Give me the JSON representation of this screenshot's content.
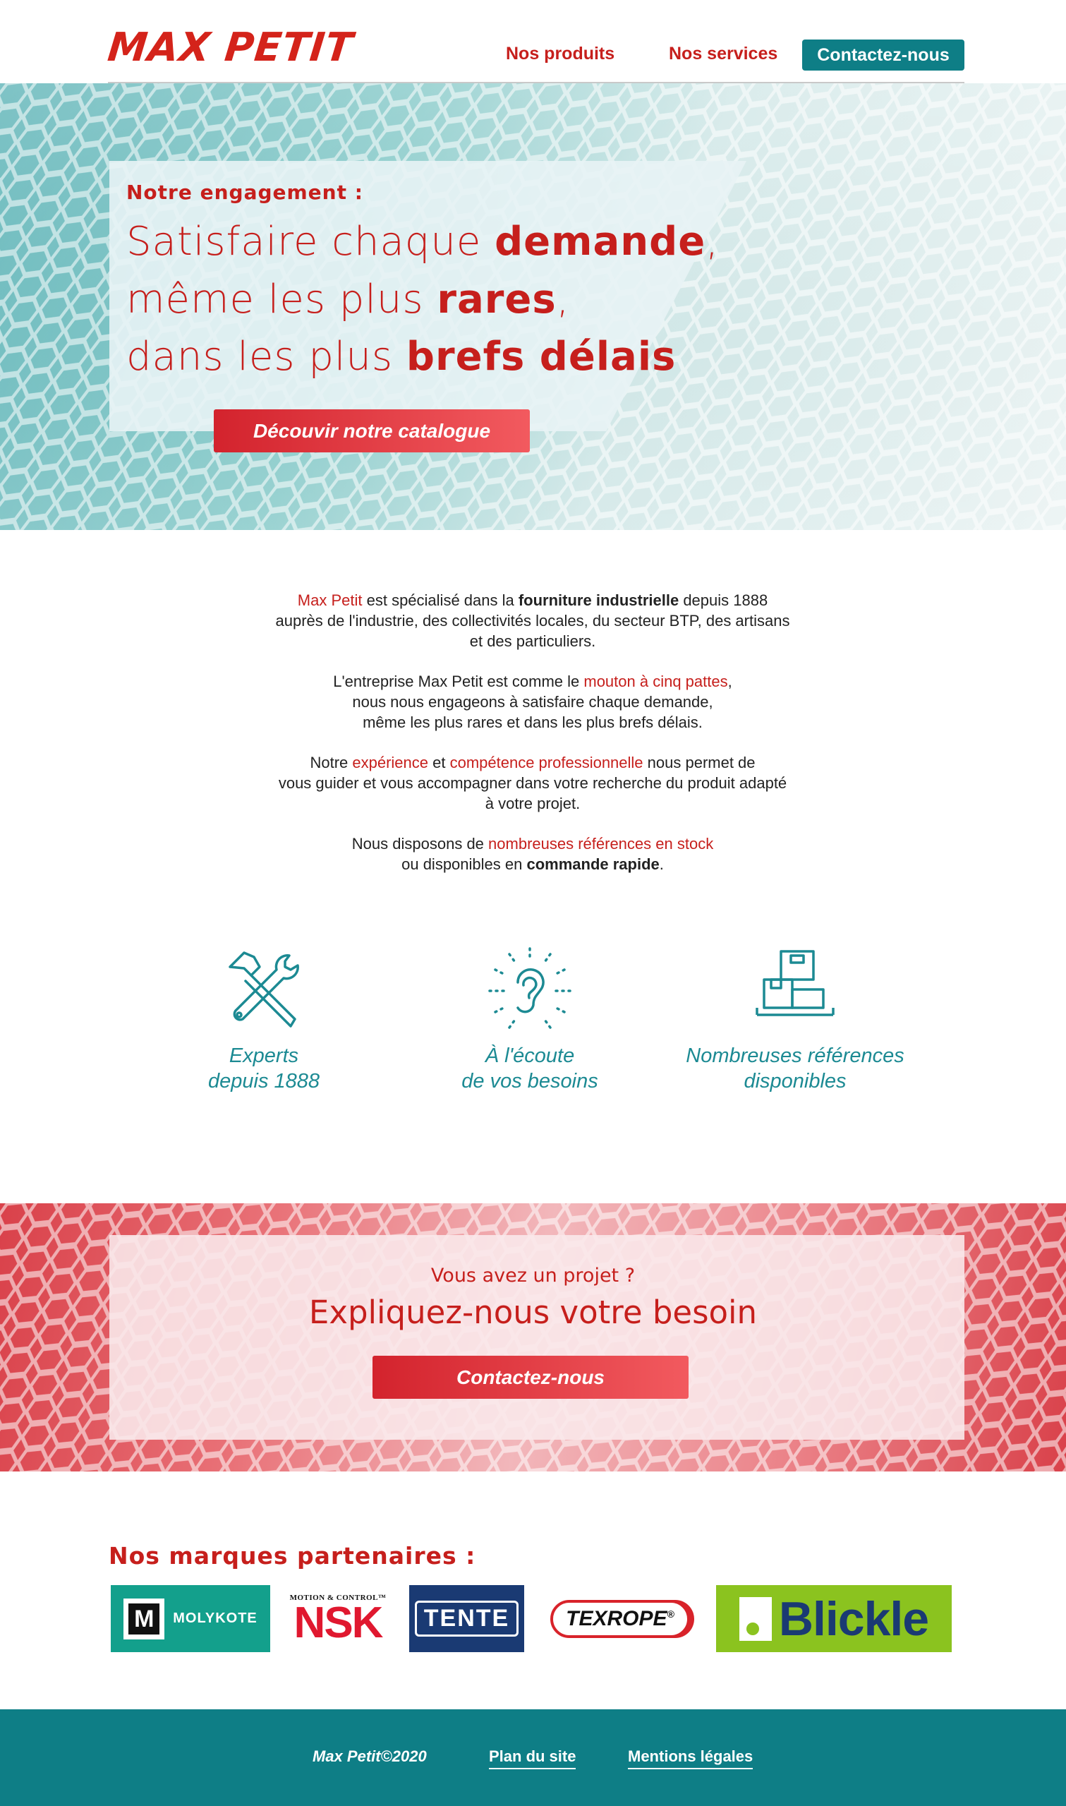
{
  "header": {
    "logo": "MAX PETIT",
    "nav": {
      "products": "Nos produits",
      "services": "Nos services",
      "contact": "Contactez-nous"
    }
  },
  "hero": {
    "kicker": "Notre engagement :",
    "line1_light": "Satisfaire chaque ",
    "line1_bold": "demande",
    "line1_end": ",",
    "line2_light": "même les plus ",
    "line2_bold": "rares",
    "line2_end": ",",
    "line3_light": "dans les plus ",
    "line3_bold": "brefs délais",
    "cta": "Découvir notre catalogue"
  },
  "intro": {
    "p1": {
      "a": "Max Petit",
      "b": " est spécialisé dans la ",
      "c": "fourniture industrielle",
      "d": " depuis 1888",
      "e": "auprès de l'industrie, des collectivités locales, du secteur BTP, des artisans",
      "f": "et des particuliers."
    },
    "p2": {
      "a": "L'entreprise Max Petit est comme le ",
      "b": "mouton à cinq pattes",
      "c": ",",
      "d": "nous nous engageons à satisfaire chaque demande,",
      "e": "même les plus rares et dans les plus brefs délais."
    },
    "p3": {
      "a": "Notre ",
      "b": "expérience",
      "c": " et ",
      "d": "compétence professionnelle",
      "e": " nous permet de",
      "f": "vous guider et vous accompagner dans votre recherche du produit adapté",
      "g": "à votre projet."
    },
    "p4": {
      "a": "Nous disposons de ",
      "b": "nombreuses références en stock",
      "c": "ou disponibles en ",
      "d": "commande rapide",
      "e": "."
    }
  },
  "features": [
    {
      "icon": "tools-icon",
      "line1": "Experts",
      "line2": "depuis 1888"
    },
    {
      "icon": "ear-icon",
      "line1": "À l'écoute",
      "line2": "de vos besoins"
    },
    {
      "icon": "boxes-icon",
      "line1": "Nombreuses références",
      "line2": "disponibles"
    }
  ],
  "project": {
    "kicker": "Vous avez un projet ?",
    "title": "Expliquez-nous votre besoin",
    "cta": "Contactez-nous"
  },
  "brands": {
    "title": "Nos marques partenaires :",
    "items": [
      {
        "name": "MOLYKOTE",
        "mark": "M"
      },
      {
        "name": "NSK",
        "tagline": "MOTION & CONTROL™"
      },
      {
        "name": "TENTE"
      },
      {
        "name": "TEXROPE",
        "mark": "®"
      },
      {
        "name": "Blickle"
      }
    ]
  },
  "footer": {
    "copyright": "Max Petit©2020",
    "sitemap": "Plan du site",
    "legal": "Mentions légales"
  },
  "colors": {
    "brand_red": "#c61f1c",
    "teal": "#0e7e86",
    "feature_teal": "#1c8a93"
  }
}
